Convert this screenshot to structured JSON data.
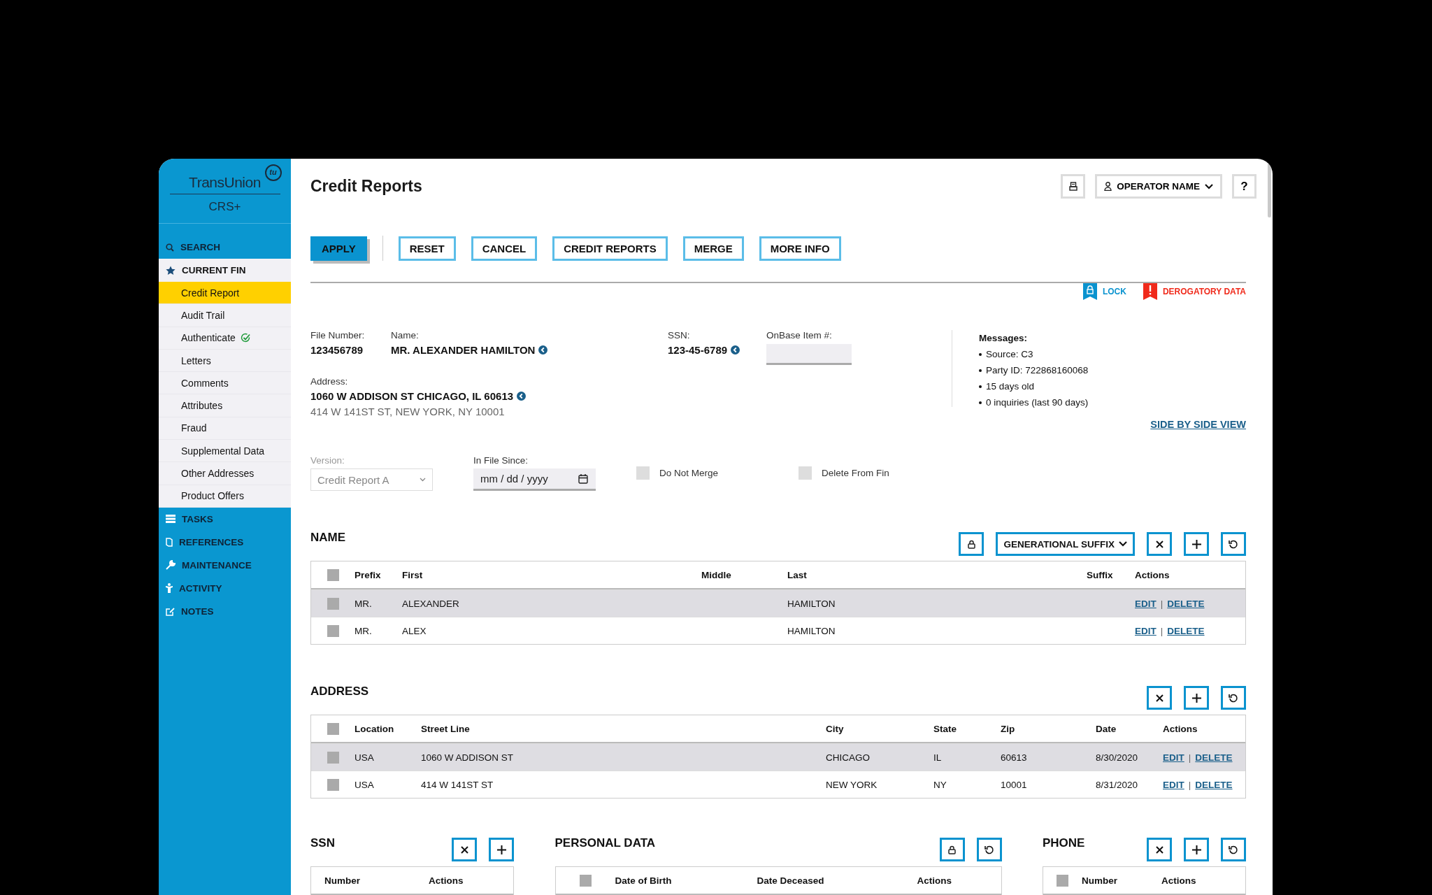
{
  "sidebar": {
    "logo": "TransUnion",
    "logo_mark": "tu",
    "product": "CRS+",
    "sections": [
      {
        "label": "SEARCH",
        "kind": "search",
        "expanded": false
      },
      {
        "label": "CURRENT FIN",
        "kind": "star",
        "expanded": true,
        "items": [
          {
            "label": "Credit Report",
            "selected": true,
            "verified": false
          },
          {
            "label": "Audit Trail",
            "selected": false,
            "verified": false
          },
          {
            "label": "Authenticate",
            "selected": false,
            "verified": true
          },
          {
            "label": "Letters",
            "selected": false,
            "verified": false
          },
          {
            "label": "Comments",
            "selected": false,
            "verified": false
          },
          {
            "label": "Attributes",
            "selected": false,
            "verified": false
          },
          {
            "label": "Fraud",
            "selected": false,
            "verified": false
          },
          {
            "label": "Supplemental Data",
            "selected": false,
            "verified": false
          },
          {
            "label": "Other Addresses",
            "selected": false,
            "verified": false
          },
          {
            "label": "Product Offers",
            "selected": false,
            "verified": false
          }
        ]
      },
      {
        "label": "TASKS",
        "kind": "tasks",
        "expanded": false
      },
      {
        "label": "REFERENCES",
        "kind": "book",
        "expanded": false
      },
      {
        "label": "MAINTENANCE",
        "kind": "wrench",
        "expanded": false
      },
      {
        "label": "ACTIVITY",
        "kind": "person",
        "expanded": false
      },
      {
        "label": "NOTES",
        "kind": "note",
        "expanded": false
      }
    ]
  },
  "header": {
    "title": "Credit Reports",
    "operator": "OPERATOR NAME",
    "help": "?"
  },
  "actions": [
    {
      "label": "APPLY",
      "primary": true
    },
    {
      "label": "RESET",
      "primary": false
    },
    {
      "label": "CANCEL",
      "primary": false
    },
    {
      "label": "CREDIT REPORTS",
      "primary": false
    },
    {
      "label": "MERGE",
      "primary": false
    },
    {
      "label": "MORE INFO",
      "primary": false
    }
  ],
  "flags": [
    {
      "kind": "lock",
      "label": "LOCK"
    },
    {
      "kind": "derogatory",
      "label": "DEROGATORY DATA"
    }
  ],
  "file": {
    "file_number": {
      "label": "File Number:",
      "value": "123456789"
    },
    "name": {
      "label": "Name:",
      "value": "MR. ALEXANDER HAMILTON"
    },
    "ssn": {
      "label": "SSN:",
      "value": "123-45-6789"
    },
    "onbase": {
      "label": "OnBase Item #:"
    },
    "address": {
      "label": "Address:",
      "value": "1060 W ADDISON ST CHICAGO, IL 60613",
      "secondary": "414 W 141ST ST, NEW YORK, NY 10001"
    },
    "messages": {
      "title": "Messages:",
      "items": [
        "Source: C3",
        "Party ID: 722868160068",
        "15 days old",
        "0 inquiries (last 90 days)"
      ]
    },
    "side_by_side": "SIDE BY SIDE VIEW"
  },
  "options": {
    "version": {
      "label": "Version:",
      "value": "Credit Report A",
      "disabled": true
    },
    "in_file_since": {
      "label": "In File Since:",
      "placeholder": "mm / dd / yyyy"
    },
    "checkboxes": [
      {
        "label": "Do Not Merge",
        "checked": false
      },
      {
        "label": "Delete From Fin",
        "checked": false
      }
    ]
  },
  "sections": [
    {
      "kind": "name",
      "title": "NAME",
      "tools": [
        {
          "kind": "lock"
        },
        {
          "kind": "dropdown",
          "label": "GENERATIONAL SUFFIX"
        },
        {
          "kind": "clear"
        },
        {
          "kind": "add"
        },
        {
          "kind": "reset"
        }
      ],
      "header_checked": false,
      "columns": [
        "Prefix",
        "First",
        "Middle",
        "Last",
        "Suffix",
        "Actions"
      ],
      "rows": [
        {
          "selected": true,
          "checked": false,
          "cells": [
            "MR.",
            "ALEXANDER",
            "",
            "HAMILTON",
            ""
          ],
          "actions": [
            "EDIT",
            "DELETE"
          ],
          "separator": "|"
        },
        {
          "selected": false,
          "checked": false,
          "cells": [
            "MR.",
            "ALEX",
            "",
            "HAMILTON",
            ""
          ],
          "actions": [
            "EDIT",
            "DELETE"
          ],
          "separator": "|"
        }
      ]
    },
    {
      "kind": "address",
      "title": "ADDRESS",
      "tools": [
        {
          "kind": "clear"
        },
        {
          "kind": "add"
        },
        {
          "kind": "reset"
        }
      ],
      "header_checked": false,
      "columns": [
        "Location",
        "Street Line",
        "City",
        "State",
        "Zip",
        "Date",
        "Actions"
      ],
      "rows": [
        {
          "selected": true,
          "checked": false,
          "cells": [
            "USA",
            "1060 W ADDISON ST",
            "CHICAGO",
            "IL",
            "60613",
            "8/30/2020"
          ],
          "actions": [
            "EDIT",
            "DELETE"
          ],
          "separator": "|"
        },
        {
          "selected": false,
          "checked": false,
          "cells": [
            "USA",
            "414 W 141ST ST",
            "NEW YORK",
            "NY",
            "10001",
            "8/31/2020"
          ],
          "actions": [
            "EDIT",
            "DELETE"
          ],
          "separator": "|"
        }
      ]
    },
    {
      "kind": "ssn",
      "title": "SSN",
      "tools": [
        {
          "kind": "clear"
        },
        {
          "kind": "add"
        }
      ],
      "columns": [
        "Number",
        "Actions"
      ]
    },
    {
      "kind": "personal",
      "title": "PERSONAL DATA",
      "tools": [
        {
          "kind": "lock"
        },
        {
          "kind": "reset"
        }
      ],
      "header_checked": false,
      "columns": [
        "Date of Birth",
        "Date Deceased",
        "Actions"
      ]
    },
    {
      "kind": "phone",
      "title": "PHONE",
      "tools": [
        {
          "kind": "clear"
        },
        {
          "kind": "add"
        },
        {
          "kind": "reset"
        }
      ],
      "header_checked": false,
      "columns": [
        "Number",
        "Actions"
      ]
    }
  ]
}
